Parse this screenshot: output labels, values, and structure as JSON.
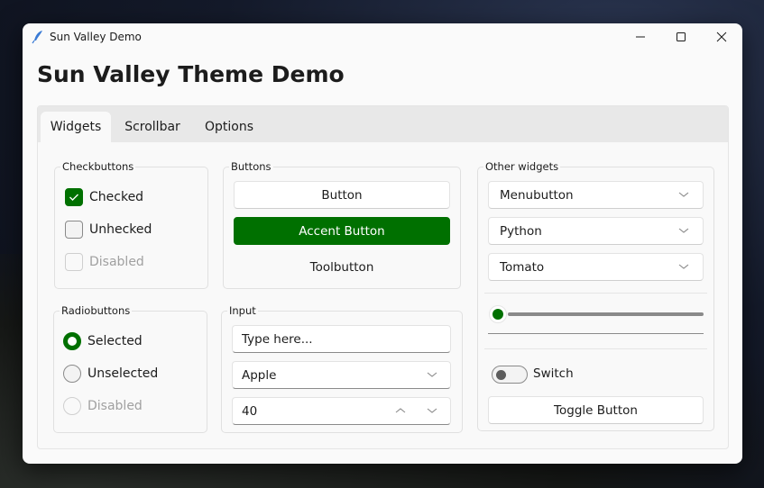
{
  "window": {
    "title": "Sun Valley Demo",
    "icon": "feather-icon",
    "controls": [
      "minimize",
      "maximize",
      "close"
    ]
  },
  "heading": "Sun Valley Theme Demo",
  "tabs": [
    {
      "label": "Widgets",
      "active": true
    },
    {
      "label": "Scrollbar",
      "active": false
    },
    {
      "label": "Options",
      "active": false
    }
  ],
  "colors": {
    "accent": "#007000",
    "window_bg": "#fafafa",
    "tabbar_bg": "#e8e8e8"
  },
  "checkbuttons": {
    "label": "Checkbuttons",
    "items": [
      {
        "label": "Checked",
        "state": "checked"
      },
      {
        "label": "Unhecked",
        "state": "unchecked"
      },
      {
        "label": "Disabled",
        "state": "disabled"
      }
    ]
  },
  "radiobuttons": {
    "label": "Radiobuttons",
    "items": [
      {
        "label": "Selected",
        "state": "selected"
      },
      {
        "label": "Unselected",
        "state": "unselected"
      },
      {
        "label": "Disabled",
        "state": "disabled"
      }
    ]
  },
  "buttons": {
    "label": "Buttons",
    "button": "Button",
    "accent_button": "Accent Button",
    "toolbutton": "Toolbutton"
  },
  "input": {
    "label": "Input",
    "entry_value": "Type here...",
    "combobox_value": "Apple",
    "spinbox_value": "40"
  },
  "other": {
    "label": "Other widgets",
    "menubutton": "Menubutton",
    "optionmenu_1": "Python",
    "optionmenu_2": "Tomato",
    "scale_value_fraction": 0,
    "progress_value_fraction": 0,
    "switch_label": "Switch",
    "switch_on": false,
    "toggle_button": "Toggle Button"
  }
}
